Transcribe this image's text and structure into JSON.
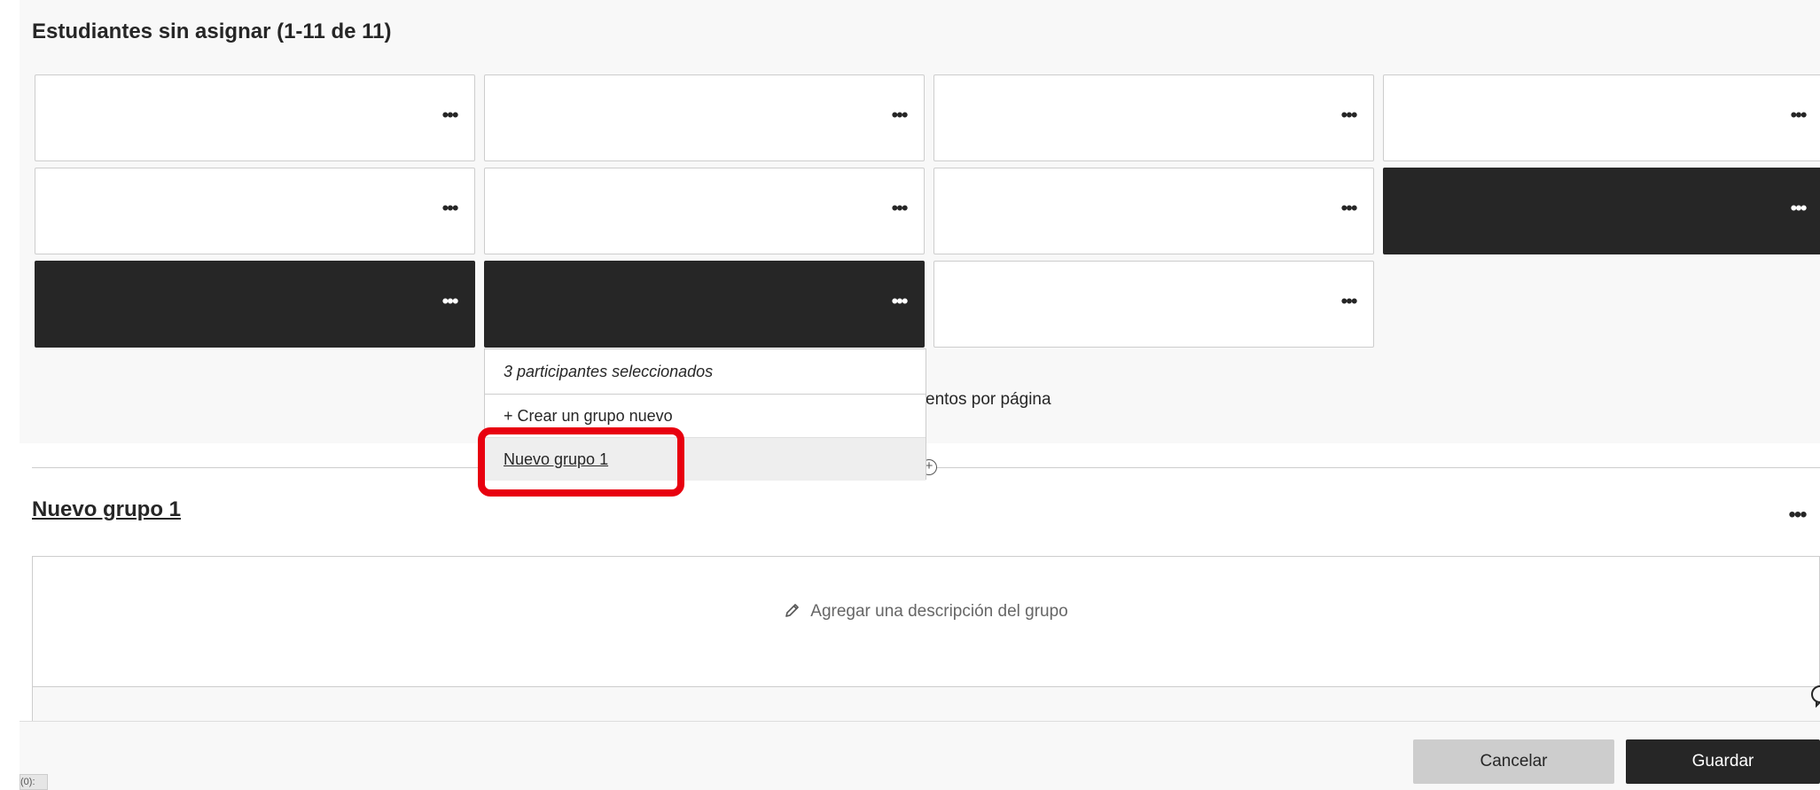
{
  "unassigned": {
    "title": "Estudiantes sin asignar  (1-11 de 11)",
    "per_page_text": "entos por página"
  },
  "cards": [
    {
      "row": 0,
      "col": 0,
      "selected": false
    },
    {
      "row": 0,
      "col": 1,
      "selected": false
    },
    {
      "row": 0,
      "col": 2,
      "selected": false
    },
    {
      "row": 0,
      "col": 3,
      "selected": false
    },
    {
      "row": 1,
      "col": 0,
      "selected": false
    },
    {
      "row": 1,
      "col": 1,
      "selected": false
    },
    {
      "row": 1,
      "col": 2,
      "selected": false
    },
    {
      "row": 1,
      "col": 3,
      "selected": true
    },
    {
      "row": 2,
      "col": 0,
      "selected": true
    },
    {
      "row": 2,
      "col": 1,
      "selected": true
    },
    {
      "row": 2,
      "col": 2,
      "selected": false
    }
  ],
  "more_icon": "•••",
  "dropdown": {
    "header": "3 participantes seleccionados",
    "create_group": "+ Crear un grupo nuevo",
    "existing_group": "Nuevo grupo 1"
  },
  "group": {
    "title": "Nuevo grupo 1",
    "description_placeholder": "Agregar una descripción del grupo"
  },
  "footer": {
    "cancel_label": "Cancelar",
    "save_label": "Guardar",
    "tag_text": "(0):"
  },
  "colors": {
    "selected_card": "#262626",
    "highlight": "#e8000f",
    "cancel_bg": "#cdcdcd",
    "save_bg": "#262626"
  }
}
